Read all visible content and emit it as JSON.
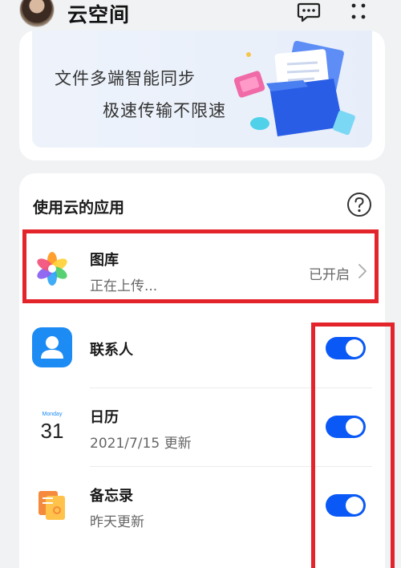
{
  "header": {
    "title": "云空间",
    "avatar_icon": "user-avatar",
    "icons": [
      "message-icon",
      "more-vertical-icon"
    ]
  },
  "banner": {
    "line1": "文件多端智能同步",
    "line2": "极速传输不限速",
    "illustration": "folder-illustration"
  },
  "apps_section": {
    "title": "使用云的应用",
    "help_icon": "help-icon",
    "rows": [
      {
        "name": "图库",
        "subtitle": "正在上传...",
        "status": "已开启",
        "icon": "gallery-icon",
        "control": "chevron"
      },
      {
        "name": "联系人",
        "icon": "contacts-icon",
        "control": "toggle",
        "enabled": true
      },
      {
        "name": "日历",
        "subtitle": "2021/7/15 更新",
        "icon": "calendar-icon",
        "icon_day": "Monday",
        "icon_date": "31",
        "control": "toggle",
        "enabled": true
      },
      {
        "name": "备忘录",
        "subtitle": "昨天更新",
        "icon": "notes-icon",
        "control": "toggle",
        "enabled": true
      }
    ]
  },
  "colors": {
    "accent": "#0a59f7",
    "highlight": "#e3252b",
    "background": "#f1f2f4"
  }
}
